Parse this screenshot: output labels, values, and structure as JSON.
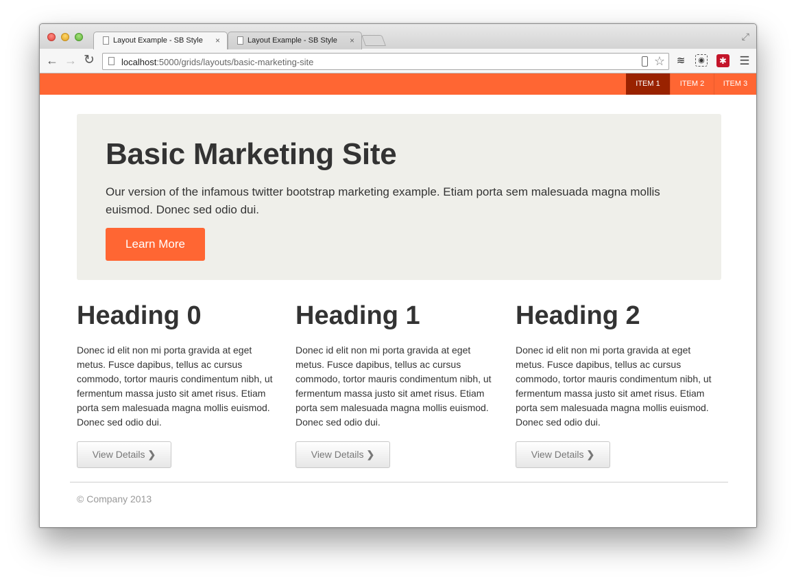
{
  "browser": {
    "tabs": [
      {
        "label": "Layout Example - SB Style",
        "close": "×"
      },
      {
        "label": "Layout Example - SB Style",
        "close": "×"
      }
    ],
    "url_host": "localhost",
    "url_path": ":5000/grids/layouts/basic-marketing-site"
  },
  "site": {
    "nav": [
      "ITEM 1",
      "ITEM 2",
      "ITEM 3"
    ],
    "hero": {
      "title": "Basic Marketing Site",
      "text": "Our version of the infamous twitter bootstrap marketing example. Etiam porta sem malesuada magna mollis euismod. Donec sed odio dui.",
      "button": "Learn More"
    },
    "columns": [
      {
        "heading": "Heading 0",
        "text": "Donec id elit non mi porta gravida at eget metus. Fusce dapibus, tellus ac cursus commodo, tortor mauris condimentum nibh, ut fermentum massa justo sit amet risus. Etiam porta sem malesuada magna mollis euismod. Donec sed odio dui.",
        "button": "View Details"
      },
      {
        "heading": "Heading 1",
        "text": "Donec id elit non mi porta gravida at eget metus. Fusce dapibus, tellus ac cursus commodo, tortor mauris condimentum nibh, ut fermentum massa justo sit amet risus. Etiam porta sem malesuada magna mollis euismod. Donec sed odio dui.",
        "button": "View Details"
      },
      {
        "heading": "Heading 2",
        "text": "Donec id elit non mi porta gravida at eget metus. Fusce dapibus, tellus ac cursus commodo, tortor mauris condimentum nibh, ut fermentum massa justo sit amet risus. Etiam porta sem malesuada magna mollis euismod. Donec sed odio dui.",
        "button": "View Details"
      }
    ],
    "footer": "© Company 2013"
  },
  "colors": {
    "accent": "#ff6633",
    "nav_active": "#992200",
    "hero_bg": "#efefea",
    "text": "#333333"
  },
  "icons": [
    "close-icon",
    "back-icon",
    "forward-icon",
    "reload-icon",
    "star-icon",
    "layers-icon",
    "evernote-icon",
    "lastpass-icon",
    "menu-icon",
    "chevron-right-icon"
  ]
}
